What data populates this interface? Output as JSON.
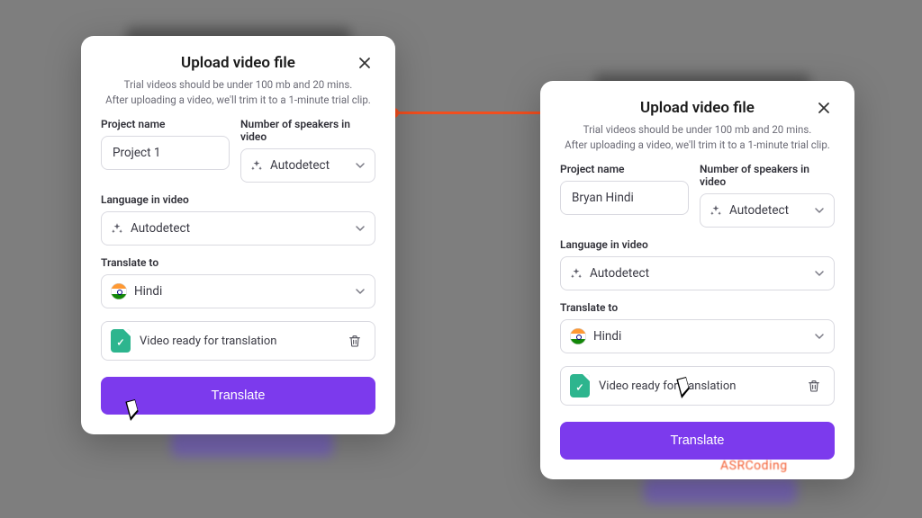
{
  "connector": {
    "color": "#f24e1e"
  },
  "modal1": {
    "title": "Upload video file",
    "sub1": "Trial videos should be under 100 mb and 20 mins.",
    "sub2": "After uploading a video, we'll trim it to a 1-minute trial clip.",
    "project_label": "Project name",
    "project_value": "Project 1",
    "speakers_label": "Number of speakers in video",
    "speakers_value": "Autodetect",
    "lang_label": "Language in video",
    "lang_value": "Autodetect",
    "translate_label": "Translate to",
    "translate_value": "Hindi",
    "file_status": "Video ready for translation",
    "submit": "Translate"
  },
  "modal2": {
    "title": "Upload video file",
    "sub1": "Trial videos should be under 100 mb and 20 mins.",
    "sub2": "After uploading a video, we'll trim it to a 1-minute trial clip.",
    "project_label": "Project name",
    "project_value": "Bryan Hindi",
    "speakers_label": "Number of speakers in video",
    "speakers_value": "Autodetect",
    "lang_label": "Language in video",
    "lang_value": "Autodetect",
    "translate_label": "Translate to",
    "translate_value": "Hindi",
    "file_status": "Video ready for translation",
    "submit": "Translate"
  },
  "watermark": "ASRCoding"
}
